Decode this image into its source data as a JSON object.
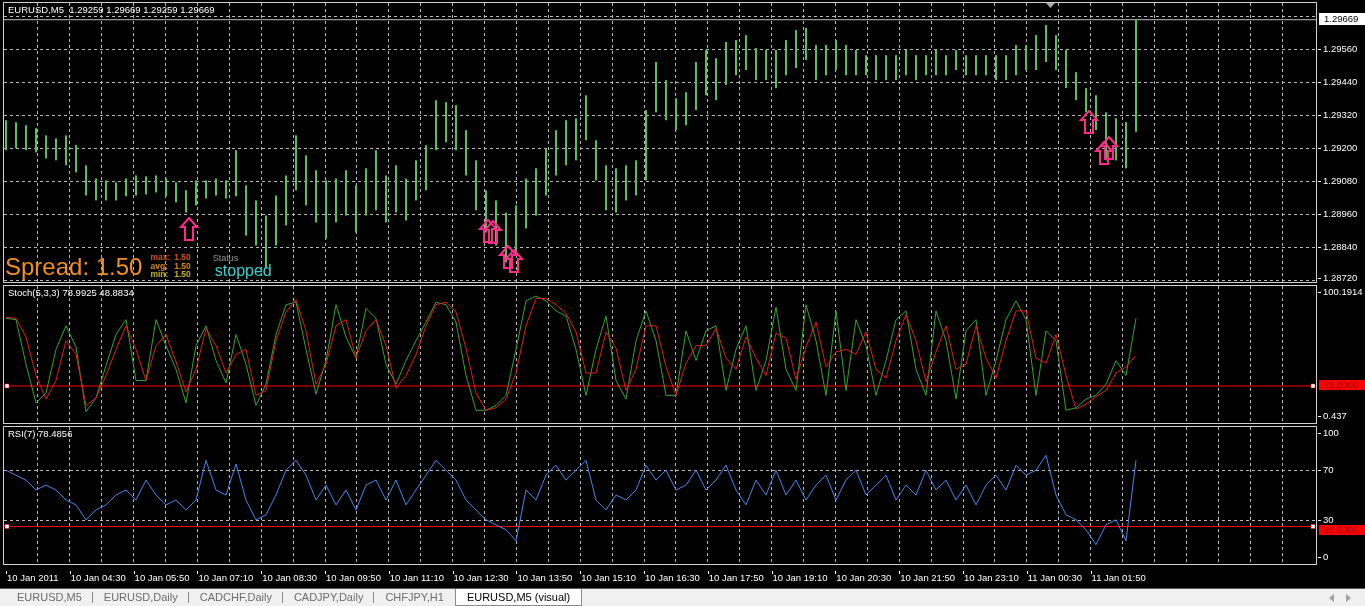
{
  "price_chart": {
    "title": "EURUSD,M5  1.29259 1.29669 1.29259 1.29669",
    "price_axis": [
      "1.29560",
      "1.29440",
      "1.29320",
      "1.29200",
      "1.29080",
      "1.28960",
      "1.28840",
      "1.28720"
    ],
    "current_price": "1.29669",
    "spread": {
      "text": "Spread: 1.50",
      "stats": [
        {
          "label": "max:",
          "value": "1.50",
          "color": "#d2521e"
        },
        {
          "label": "avg:",
          "value": "1.50",
          "color": "#d68a1e"
        },
        {
          "label": "min:",
          "value": "1.50",
          "color": "#c2b425"
        }
      ],
      "status_label": "Status",
      "status": "stopped"
    }
  },
  "stochastic": {
    "chart_data": {
      "type": "line",
      "title": "Stoch(5,3,3) 78.9925 48.8834",
      "ylim": [
        -5.19,
        105.02
      ],
      "grid": true,
      "series": [
        {
          "color": "#2fa82f",
          "values": [
            79,
            78,
            42,
            11,
            19,
            54,
            73,
            56,
            4,
            15,
            41,
            66,
            78,
            29,
            29,
            78,
            57,
            38,
            11,
            57,
            73,
            45,
            27,
            66,
            42,
            9,
            26,
            66,
            90,
            92,
            54,
            18,
            45,
            90,
            64,
            47,
            87,
            79,
            42,
            26,
            45,
            61,
            76,
            92,
            90,
            76,
            33,
            5,
            5,
            9,
            17,
            54,
            93,
            97,
            93,
            85,
            81,
            54,
            17,
            54,
            81,
            29,
            14,
            61,
            85,
            61,
            17,
            17,
            69,
            45,
            69,
            73,
            21,
            54,
            73,
            21,
            45,
            88,
            38,
            21,
            90,
            61,
            17,
            85,
            21,
            78,
            57,
            17,
            45,
            78,
            85,
            38,
            17,
            85,
            61,
            14,
            69,
            78,
            17,
            45,
            78,
            93,
            78,
            17,
            69,
            61,
            5,
            7,
            14,
            17,
            26,
            45,
            33,
            79
          ]
        },
        {
          "color": "#e81818",
          "values": [
            80,
            79,
            64,
            33,
            14,
            29,
            61,
            50,
            9,
            15,
            33,
            54,
            73,
            54,
            29,
            57,
            66,
            44,
            20,
            38,
            71,
            57,
            35,
            50,
            54,
            17,
            21,
            61,
            84,
            94,
            69,
            26,
            42,
            73,
            78,
            47,
            69,
            78,
            57,
            23,
            33,
            50,
            73,
            90,
            92,
            84,
            55,
            19,
            5,
            7,
            14,
            35,
            73,
            95,
            95,
            90,
            83,
            68,
            35,
            35,
            68,
            55,
            21,
            38,
            73,
            73,
            40,
            17,
            43,
            57,
            57,
            71,
            47,
            38,
            64,
            47,
            33,
            67,
            63,
            30,
            56,
            76,
            40,
            52,
            54,
            50,
            68,
            38,
            31,
            61,
            82,
            61,
            28,
            52,
            73,
            38,
            42,
            73,
            47,
            31,
            61,
            85,
            85,
            47,
            43,
            66,
            33,
            6,
            10,
            16,
            21,
            35,
            40,
            49
          ]
        }
      ],
      "yticks": [
        {
          "value": 100.1914,
          "label": "100.1914"
        },
        {
          "value": 0.437,
          "label": "0.437"
        }
      ],
      "ref_lines": [
        {
          "axis": "y",
          "value": 25,
          "label": "25.0000",
          "color": "#ff0000"
        }
      ]
    }
  },
  "rsi": {
    "chart_data": {
      "type": "line",
      "title": "RSI(7) 78.4856",
      "ylim": [
        -5.65,
        104.84
      ],
      "grid": true,
      "series": [
        {
          "color": "#4a86e8",
          "values": [
            70,
            66,
            62,
            54,
            58,
            54,
            46,
            42,
            30,
            38,
            42,
            50,
            54,
            46,
            62,
            50,
            42,
            46,
            38,
            46,
            78,
            54,
            50,
            75,
            46,
            30,
            34,
            50,
            70,
            78,
            66,
            46,
            58,
            42,
            54,
            38,
            58,
            62,
            46,
            62,
            42,
            54,
            66,
            78,
            70,
            62,
            46,
            38,
            30,
            26,
            22,
            13,
            54,
            46,
            66,
            74,
            62,
            70,
            78,
            46,
            38,
            50,
            46,
            54,
            74,
            62,
            70,
            54,
            58,
            70,
            54,
            62,
            74,
            54,
            42,
            62,
            50,
            70,
            50,
            62,
            46,
            58,
            66,
            46,
            62,
            70,
            50,
            58,
            66,
            46,
            58,
            50,
            70,
            54,
            62,
            46,
            58,
            42,
            58,
            66,
            54,
            74,
            66,
            70,
            82,
            50,
            34,
            30,
            22,
            10,
            26,
            30,
            13,
            78
          ]
        }
      ],
      "yticks": [
        {
          "value": 100,
          "label": "100"
        },
        {
          "value": 70,
          "label": "70"
        },
        {
          "value": 30,
          "label": "30"
        },
        {
          "value": 0,
          "label": "0"
        }
      ],
      "ref_lines": [
        {
          "axis": "y",
          "value": 70,
          "color": "#b8b8b8"
        },
        {
          "axis": "y",
          "value": 30,
          "color": "#b8b8b8"
        },
        {
          "axis": "y",
          "value": 25,
          "label": "25.0000",
          "color": "#ff0000"
        }
      ]
    }
  },
  "time_axis": [
    "10 Jan 2011",
    "10 Jan 04:30",
    "10 Jan 05:50",
    "10 Jan 07:10",
    "10 Jan 08:30",
    "10 Jan 09:50",
    "10 Jan 11:10",
    "10 Jan 12:30",
    "10 Jan 13:50",
    "10 Jan 15:10",
    "10 Jan 16:30",
    "10 Jan 17:50",
    "10 Jan 19:10",
    "10 Jan 20:30",
    "10 Jan 21:50",
    "10 Jan 23:10",
    "11 Jan 00:30",
    "11 Jan 01:50"
  ],
  "tabs": [
    {
      "label": "EURUSD,M5",
      "selected": false
    },
    {
      "label": "EURUSD,Daily",
      "selected": false
    },
    {
      "label": "CADCHF,Daily",
      "selected": false
    },
    {
      "label": "CADJPY,Daily",
      "selected": false
    },
    {
      "label": "CHFJPY,H1",
      "selected": false
    },
    {
      "label": "EURUSD,M5 (visual)",
      "selected": true
    }
  ]
}
